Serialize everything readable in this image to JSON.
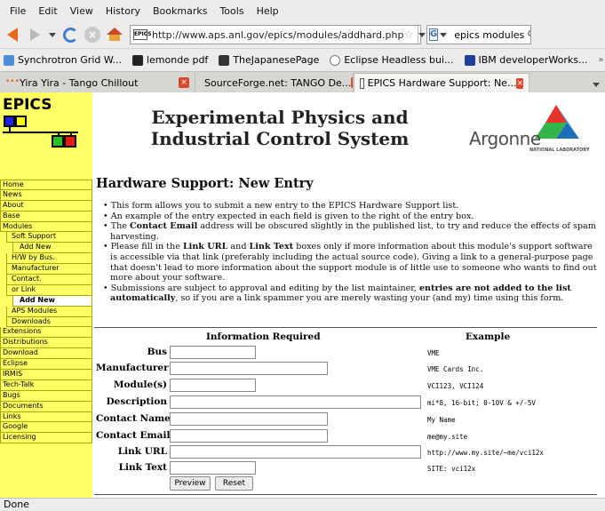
{
  "menubar": {
    "items": [
      "File",
      "Edit",
      "View",
      "History",
      "Bookmarks",
      "Tools",
      "Help"
    ]
  },
  "navbar": {
    "url": "http://www.aps.anl.gov/epics/modules/addhard.php",
    "favicon_text": "EPICS",
    "search_text": "epics modules",
    "icons": [
      "back-arrow-icon",
      "forward-arrow-icon",
      "history-dropdown-icon",
      "reload-icon",
      "stop-icon",
      "home-icon",
      "bookmark-star-icon",
      "google-icon",
      "magnifier-icon"
    ]
  },
  "bookmarks": {
    "items": [
      "Synchrotron Grid W...",
      "lemonde pdf",
      "TheJapanesePage",
      "Eclipse Headless bui...",
      "IBM developerWorks..."
    ],
    "more": "»"
  },
  "tabs": {
    "items": [
      "Yira Yira - Tango Chillout",
      "SourceForge.net: TANGO De...",
      "EPICS Hardware Support: Ne..."
    ],
    "active_index": 2
  },
  "sidebar": {
    "logo_text": "EPICS",
    "nav": [
      {
        "label": "Home",
        "level": 0
      },
      {
        "label": "News",
        "level": 0
      },
      {
        "label": "About",
        "level": 0
      },
      {
        "label": "Base",
        "level": 0
      },
      {
        "label": "Modules",
        "level": 0
      },
      {
        "label": "Soft Support",
        "level": 1
      },
      {
        "label": "Add New",
        "level": 2
      },
      {
        "label": "H/W by Bus.",
        "level": 1
      },
      {
        "label": "Manufacturer",
        "level": 1
      },
      {
        "label": "Contact.",
        "level": 1
      },
      {
        "label": "or Link",
        "level": 1
      },
      {
        "label": "Add New",
        "level": 2,
        "selected": true
      },
      {
        "label": "APS Modules",
        "level": 1
      },
      {
        "label": "Downloads",
        "level": 1
      },
      {
        "label": "Extensions",
        "level": 0
      },
      {
        "label": "Distributions",
        "level": 0
      },
      {
        "label": "Download",
        "level": 0
      },
      {
        "label": "Eclipse",
        "level": 0
      },
      {
        "label": "IRMIS",
        "level": 0
      },
      {
        "label": "Tech-Talk",
        "level": 0
      },
      {
        "label": "Bugs",
        "level": 0
      },
      {
        "label": "Documents",
        "level": 0
      },
      {
        "label": "Links",
        "level": 0
      },
      {
        "label": "Google",
        "level": 0
      },
      {
        "label": "Licensing",
        "level": 0
      }
    ]
  },
  "header": {
    "title_line1": "Experimental Physics and",
    "title_line2": "Industrial Control System",
    "argonne": "Argonne",
    "argonne_sub": "NATIONAL LABORATORY"
  },
  "content": {
    "title": "Hardware Support: New Entry",
    "b1": "This form allows you to submit a new entry to the EPICS Hardware Support list.",
    "b2": "An example of the entry expected in each field is given to the right of the entry box.",
    "b3_pre": "The ",
    "b3_bold": "Contact Email",
    "b3_post": " address will be obscured slightly in the published list, to try and reduce the effects of spam harvesting.",
    "b4_pre": "Please fill in the ",
    "b4_bold1": "Link URL",
    "b4_mid": " and ",
    "b4_bold2": "Link Text",
    "b4_post": " boxes only if more information about this module's support software is accessible via that link (preferably including the actual source code). Giving a link to a general-purpose page that doesn't lead to more information about the support module is of little use to someone who wants to find out more about your software.",
    "b5_pre": "Submissions are subject to approval and editing by the list maintainer, ",
    "b5_bold": "entries are not added to the list automatically",
    "b5_post": ", so if you are a link spammer you are merely wasting your (and my) time using this form."
  },
  "form": {
    "head_required": "Information Required",
    "head_example": "Example",
    "fields": [
      {
        "label": "Bus",
        "value": "",
        "example": "VME"
      },
      {
        "label": "Manufacturer",
        "value": "",
        "example": "VME Cards Inc."
      },
      {
        "label": "Module(s)",
        "value": "",
        "example": "VCI123, VCI124"
      },
      {
        "label": "Description",
        "value": "",
        "example": "mi*8, 16-bit; 0-10V & +/-5V"
      },
      {
        "label": "Contact Name",
        "value": "",
        "example": "My Name"
      },
      {
        "label": "Contact Email",
        "value": "",
        "example": "me@my.site"
      },
      {
        "label": "Link URL",
        "value": "",
        "example": "http://www.my.site/~me/vci12x"
      },
      {
        "label": "Link Text",
        "value": "",
        "example": "SITE: vci12x"
      }
    ],
    "preview_label": "Preview",
    "reset_label": "Reset"
  },
  "status": {
    "text": "Done"
  }
}
